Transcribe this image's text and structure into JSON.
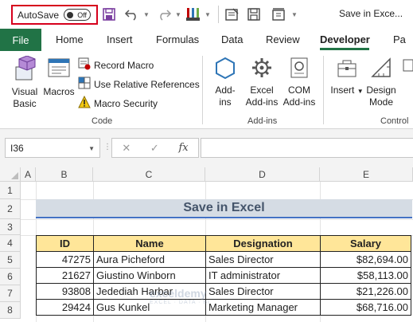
{
  "titlebar": {
    "autosave_label": "AutoSave",
    "autosave_state": "Off",
    "doc_title": "Save in Exce...",
    "icons": [
      "save-icon",
      "undo-icon",
      "redo-icon",
      "brush-icon",
      "more-icon",
      "form-icon",
      "save-as-icon",
      "window-icon",
      "quick-print-icon"
    ]
  },
  "tabs": [
    "File",
    "Home",
    "Insert",
    "Formulas",
    "Data",
    "Review",
    "Developer",
    "Pa"
  ],
  "active_tab": "Developer",
  "ribbon": {
    "code": {
      "visual_basic": [
        "Visual",
        "Basic"
      ],
      "macros": "Macros",
      "record_macro": "Record Macro",
      "relative_refs": "Use Relative References",
      "macro_security": "Macro Security",
      "label": "Code"
    },
    "addins": {
      "addins": [
        "Add-",
        "ins"
      ],
      "excel_addins": [
        "Excel",
        "Add-ins"
      ],
      "com_addins": [
        "COM",
        "Add-ins"
      ],
      "label": "Add-ins"
    },
    "controls": {
      "insert": "Insert",
      "design_mode": [
        "Design",
        "Mode"
      ],
      "label": "Control"
    }
  },
  "formula_bar": {
    "name_box": "I36",
    "fx": "fx",
    "formula": ""
  },
  "grid": {
    "columns": [
      "A",
      "B",
      "C",
      "D",
      "E"
    ],
    "rows": [
      "1",
      "2",
      "3",
      "4",
      "5",
      "6",
      "7",
      "8"
    ],
    "title": "Save in Excel",
    "headers": [
      "ID",
      "Name",
      "Designation",
      "Salary"
    ],
    "data": [
      [
        "47275",
        "Aura Picheford",
        "Sales Director",
        "$82,694.00"
      ],
      [
        "21627",
        "Giustino Winborn",
        "IT administrator",
        "$58,113.00"
      ],
      [
        "93808",
        "Jedediah Harbar",
        "Sales Director",
        "$21,226.00"
      ],
      [
        "29424",
        "Gus Kunkel",
        "Marketing Manager",
        "$68,716.00"
      ]
    ]
  },
  "watermark": {
    "main": "exceldemy",
    "sub": "EXCEL · DATA · BI"
  },
  "colors": {
    "file_tab": "#217346",
    "header_fill": "#ffe699",
    "title_fill": "#d5dce4",
    "title_text": "#44546a",
    "autosave_border": "#d6001c"
  }
}
